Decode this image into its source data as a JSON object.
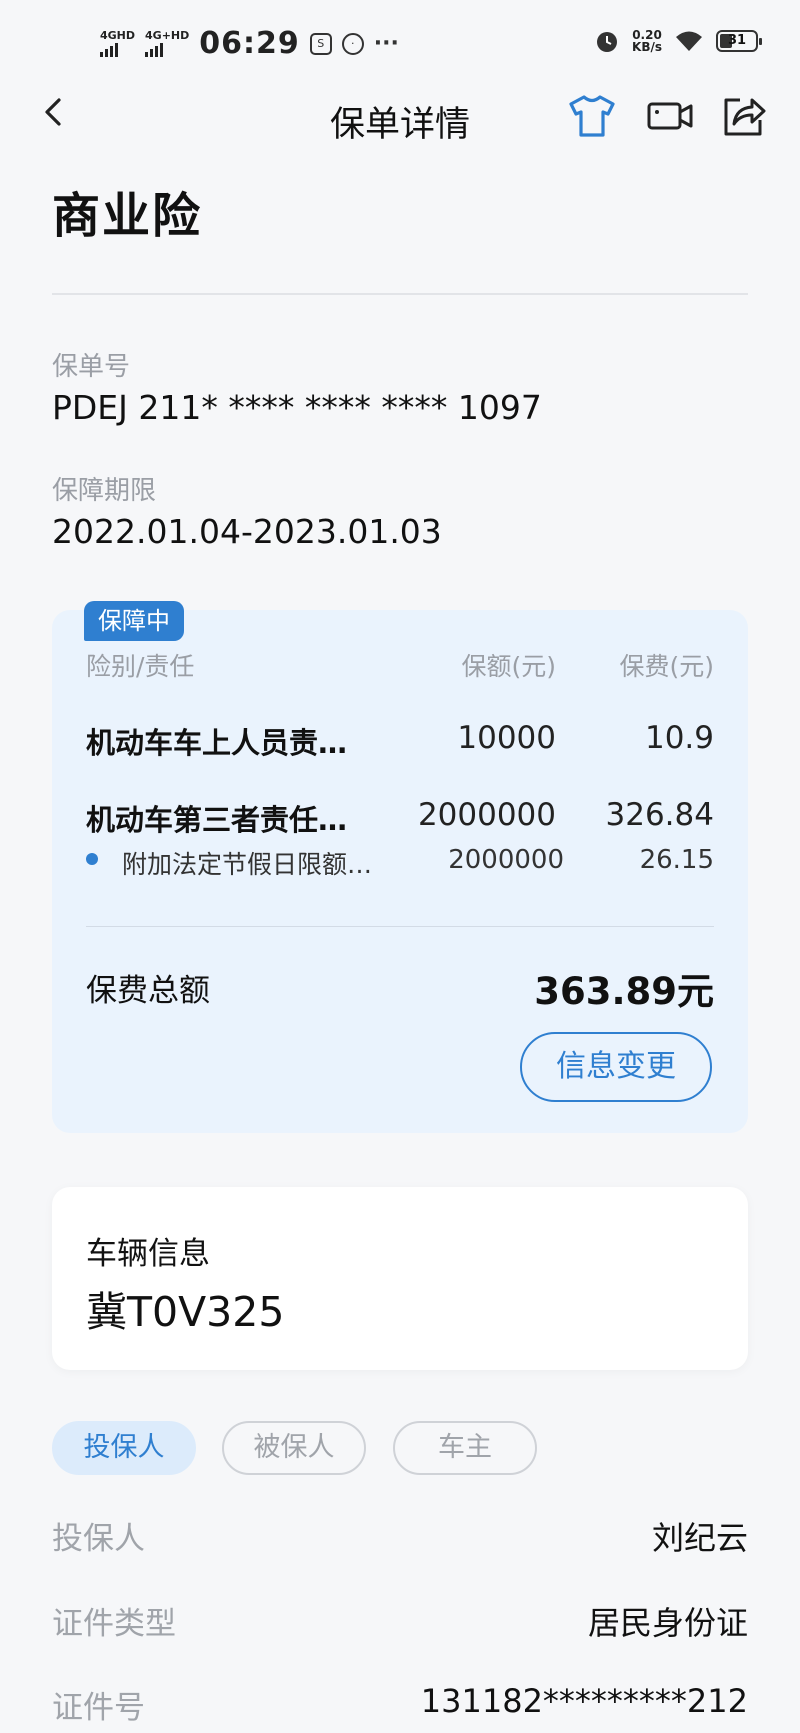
{
  "status_bar": {
    "signal1": "4GHD",
    "signal2": "4G+HD",
    "time": "06:29",
    "notif_icon1": "S",
    "dots": "···",
    "speed_value": "0.20",
    "speed_unit": "KB/s",
    "battery": "31"
  },
  "header": {
    "title": "保单详情"
  },
  "policy": {
    "type_title": "商业险",
    "number_label": "保单号",
    "number_value": "PDEJ 211* **** **** **** 1097",
    "period_label": "保障期限",
    "period_value": "2022.01.04-2023.01.03"
  },
  "coverage": {
    "status_badge": "保障中",
    "col_name": "险别/责任",
    "col_amount": "保额(元)",
    "col_premium": "保费(元)",
    "rows": [
      {
        "name": "机动车车上人员责…",
        "amount": "10000",
        "premium": "10.9"
      },
      {
        "name": "机动车第三者责任…",
        "amount": "2000000",
        "premium": "326.84"
      }
    ],
    "sub_row": {
      "name": "附加法定节假日限额…",
      "amount": "2000000",
      "premium": "26.15"
    },
    "total_label": "保费总额",
    "total_value": "363.89元",
    "change_button": "信息变更"
  },
  "vehicle": {
    "label": "车辆信息",
    "plate": "冀T0V325"
  },
  "tabs": [
    {
      "label": "投保人"
    },
    {
      "label": "被保人"
    },
    {
      "label": "车主"
    }
  ],
  "holder": [
    {
      "key": "投保人",
      "value": "刘纪云"
    },
    {
      "key": "证件类型",
      "value": "居民身份证"
    },
    {
      "key": "证件号",
      "value": "131182*********212"
    }
  ],
  "colors": {
    "accent": "#2f7fd0",
    "card_bg": "#eaf3fd",
    "page_bg": "#f6f7f9"
  }
}
